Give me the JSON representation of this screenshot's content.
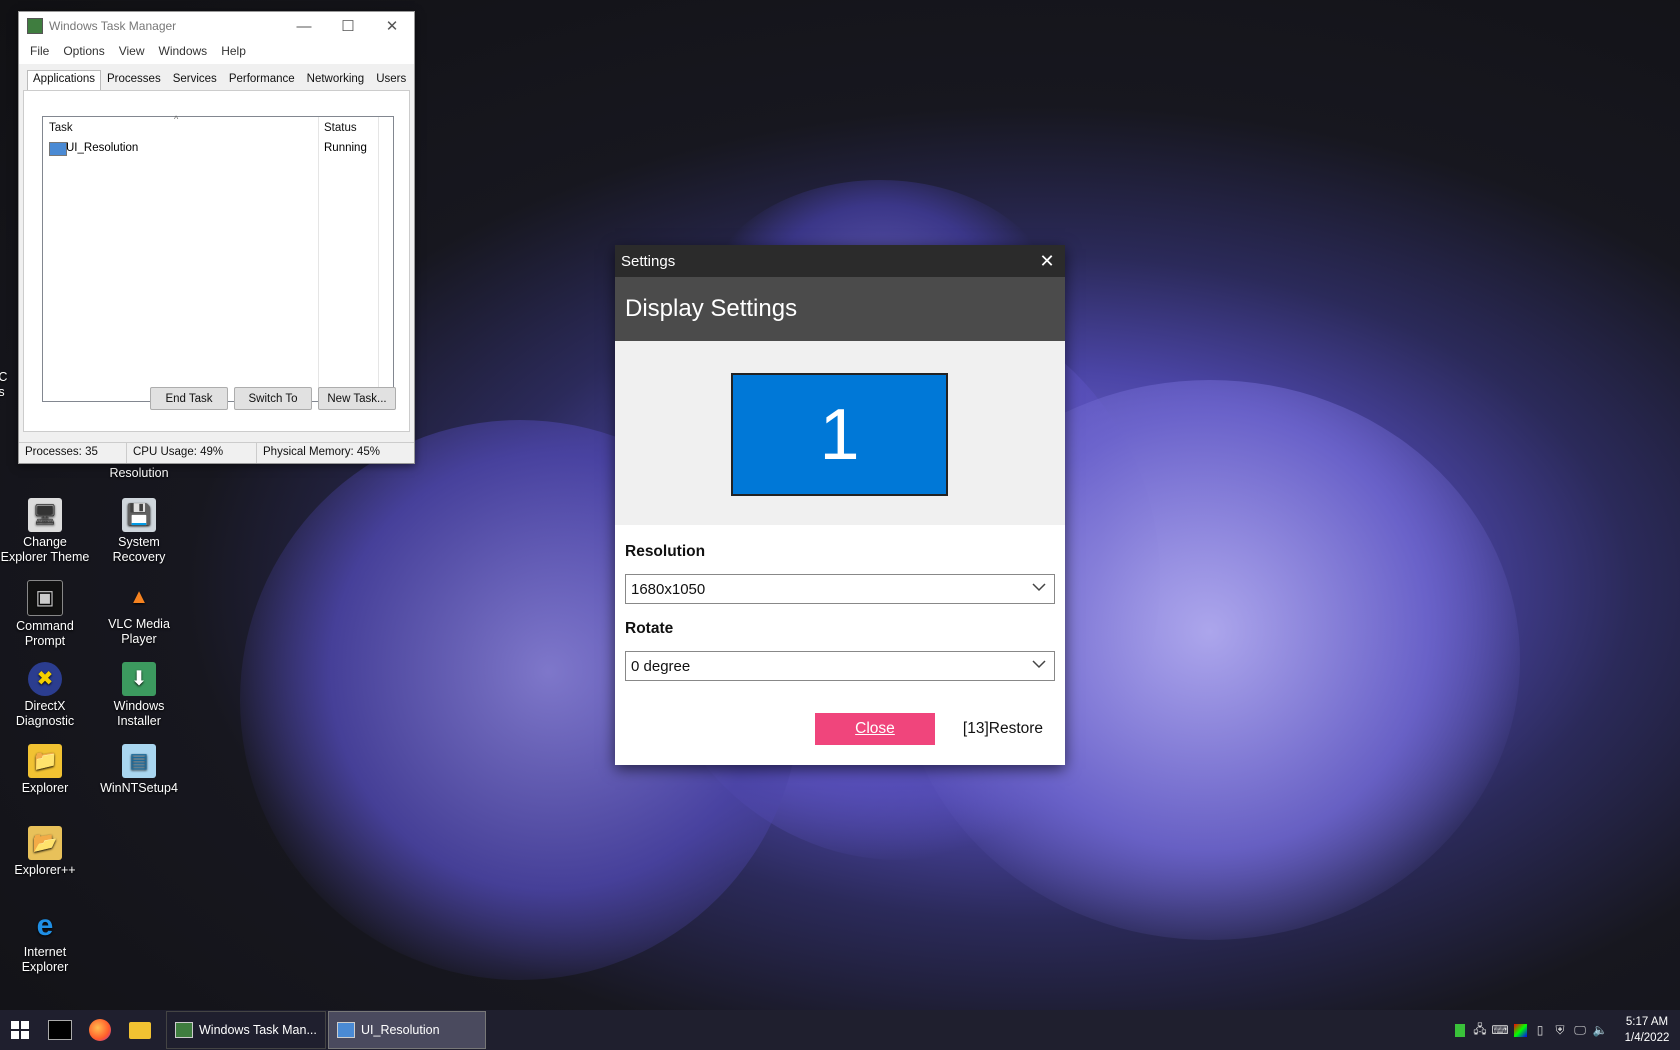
{
  "desktop": {
    "icons": [
      {
        "label": "Change Explorer Theme",
        "glyph": "🖥",
        "name": "change-explorer-theme-icon"
      },
      {
        "label": "System Recovery",
        "glyph": "💾",
        "name": "system-recovery-icon"
      },
      {
        "label": "Command Prompt",
        "glyph": "▣",
        "name": "command-prompt-icon"
      },
      {
        "label": "VLC Media Player",
        "glyph": "▲",
        "name": "vlc-icon"
      },
      {
        "label": "DirectX Diagnostic",
        "glyph": "✖",
        "name": "directx-icon"
      },
      {
        "label": "Windows Installer",
        "glyph": "⬇",
        "name": "windows-installer-icon"
      },
      {
        "label": "Explorer",
        "glyph": "📁",
        "name": "explorer-icon"
      },
      {
        "label": "WinNTSetup4",
        "glyph": "▤",
        "name": "winntsetup-icon"
      },
      {
        "label": "Explorer++",
        "glyph": "📂",
        "name": "explorer-plus-icon"
      },
      {
        "label": "Internet Explorer",
        "glyph": "e",
        "name": "internet-explorer-icon"
      }
    ],
    "partial_labels": {
      "left_edge_1": "AC",
      "left_edge_2": "As",
      "resolution_label": "Resolution"
    }
  },
  "task_manager": {
    "title": "Windows Task Manager",
    "menu": [
      "File",
      "Options",
      "View",
      "Windows",
      "Help"
    ],
    "tabs": [
      "Applications",
      "Processes",
      "Services",
      "Performance",
      "Networking",
      "Users"
    ],
    "columns": {
      "task": "Task",
      "status": "Status"
    },
    "rows": [
      {
        "task": "UI_Resolution",
        "status": "Running"
      }
    ],
    "buttons": {
      "end_task": "End Task",
      "switch_to": "Switch To",
      "new_task": "New Task..."
    },
    "status": {
      "processes": "Processes: 35",
      "cpu": "CPU Usage: 49%",
      "memory": "Physical Memory: 45%"
    }
  },
  "settings": {
    "title": "Settings",
    "header": "Display Settings",
    "monitor_number": "1",
    "resolution_label": "Resolution",
    "resolution_value": "1680x1050",
    "rotate_label": "Rotate",
    "rotate_value": "0 degree",
    "close_label": "Close",
    "restore_label": "[13]Restore"
  },
  "taskbar": {
    "tasks": [
      {
        "label": "Windows Task Man...",
        "active": false
      },
      {
        "label": "UI_Resolution",
        "active": true
      }
    ],
    "clock": {
      "time": "5:17 AM",
      "date": "1/4/2022"
    }
  }
}
